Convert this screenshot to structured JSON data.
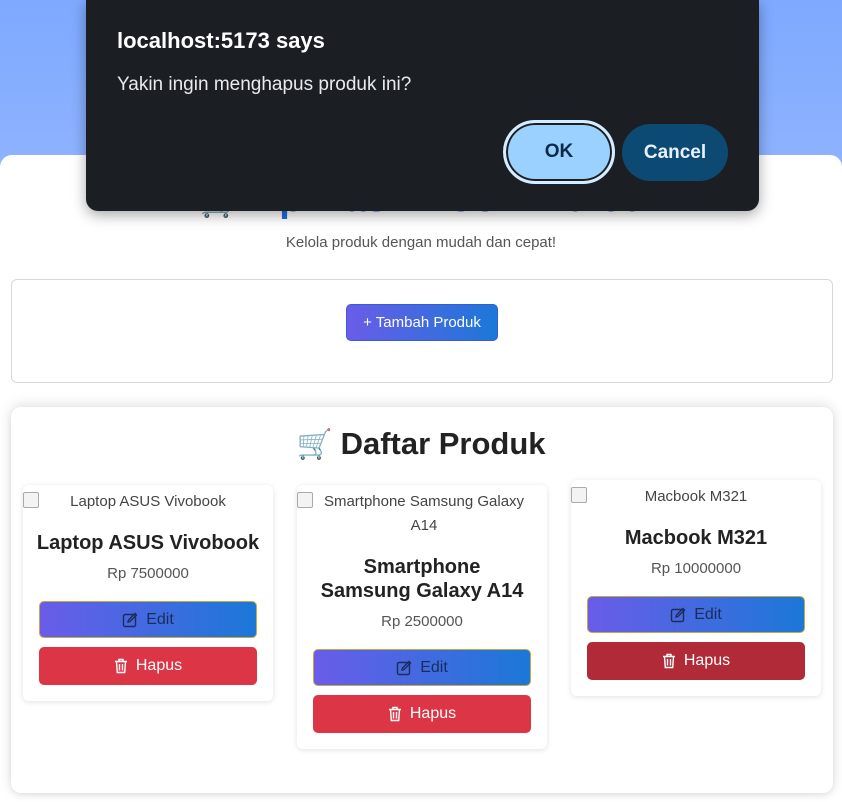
{
  "dialog": {
    "title": "localhost:5173 says",
    "message": "Yakin ingin menghapus produk ini?",
    "ok_label": "OK",
    "cancel_label": "Cancel"
  },
  "header": {
    "cart_icon": "🛒",
    "title": "Aplikasi E-Commerce",
    "subtitle": "Kelola produk dengan mudah dan cepat!"
  },
  "actions": {
    "add_label": "+ Tambah Produk"
  },
  "product_list": {
    "cart_icon": "🛒",
    "title": "Daftar Produk",
    "products": [
      {
        "image_alt": "Laptop ASUS Vivobook",
        "name": "Laptop ASUS Vivobook",
        "price": "Rp 7500000",
        "edit_label": "Edit",
        "delete_label": "Hapus"
      },
      {
        "image_alt": "Smartphone Samsung Galaxy A14",
        "name": "Smartphone Samsung Galaxy A14",
        "price": "Rp 2500000",
        "edit_label": "Edit",
        "delete_label": "Hapus"
      },
      {
        "image_alt": "Macbook M321",
        "name": "Macbook M321",
        "price": "Rp 10000000",
        "edit_label": "Edit",
        "delete_label": "Hapus"
      }
    ]
  },
  "colors": {
    "accent": "#1e6fe0",
    "danger": "#dc3545",
    "dialog_bg": "#1b1f24"
  }
}
